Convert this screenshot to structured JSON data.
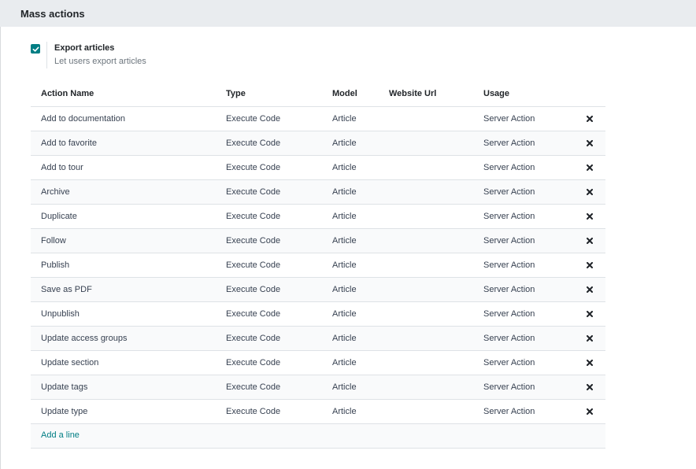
{
  "section": {
    "title": "Mass actions"
  },
  "setting": {
    "checked": true,
    "title": "Export articles",
    "description": "Let users export articles"
  },
  "table": {
    "columns": [
      "Action Name",
      "Type",
      "Model",
      "Website Url",
      "Usage"
    ],
    "rows": [
      {
        "name": "Add to documentation",
        "type": "Execute Code",
        "model": "Article",
        "url": "",
        "usage": "Server Action"
      },
      {
        "name": "Add to favorite",
        "type": "Execute Code",
        "model": "Article",
        "url": "",
        "usage": "Server Action"
      },
      {
        "name": "Add to tour",
        "type": "Execute Code",
        "model": "Article",
        "url": "",
        "usage": "Server Action"
      },
      {
        "name": "Archive",
        "type": "Execute Code",
        "model": "Article",
        "url": "",
        "usage": "Server Action"
      },
      {
        "name": "Duplicate",
        "type": "Execute Code",
        "model": "Article",
        "url": "",
        "usage": "Server Action"
      },
      {
        "name": "Follow",
        "type": "Execute Code",
        "model": "Article",
        "url": "",
        "usage": "Server Action"
      },
      {
        "name": "Publish",
        "type": "Execute Code",
        "model": "Article",
        "url": "",
        "usage": "Server Action"
      },
      {
        "name": "Save as PDF",
        "type": "Execute Code",
        "model": "Article",
        "url": "",
        "usage": "Server Action"
      },
      {
        "name": "Unpublish",
        "type": "Execute Code",
        "model": "Article",
        "url": "",
        "usage": "Server Action"
      },
      {
        "name": "Update access groups",
        "type": "Execute Code",
        "model": "Article",
        "url": "",
        "usage": "Server Action"
      },
      {
        "name": "Update section",
        "type": "Execute Code",
        "model": "Article",
        "url": "",
        "usage": "Server Action"
      },
      {
        "name": "Update tags",
        "type": "Execute Code",
        "model": "Article",
        "url": "",
        "usage": "Server Action"
      },
      {
        "name": "Update type",
        "type": "Execute Code",
        "model": "Article",
        "url": "",
        "usage": "Server Action"
      }
    ],
    "add_line_label": "Add a line"
  },
  "icons": {
    "checkbox": "check-icon",
    "delete": "close-icon"
  },
  "colors": {
    "accent": "#017e84",
    "header_bg": "#e9ecef"
  }
}
